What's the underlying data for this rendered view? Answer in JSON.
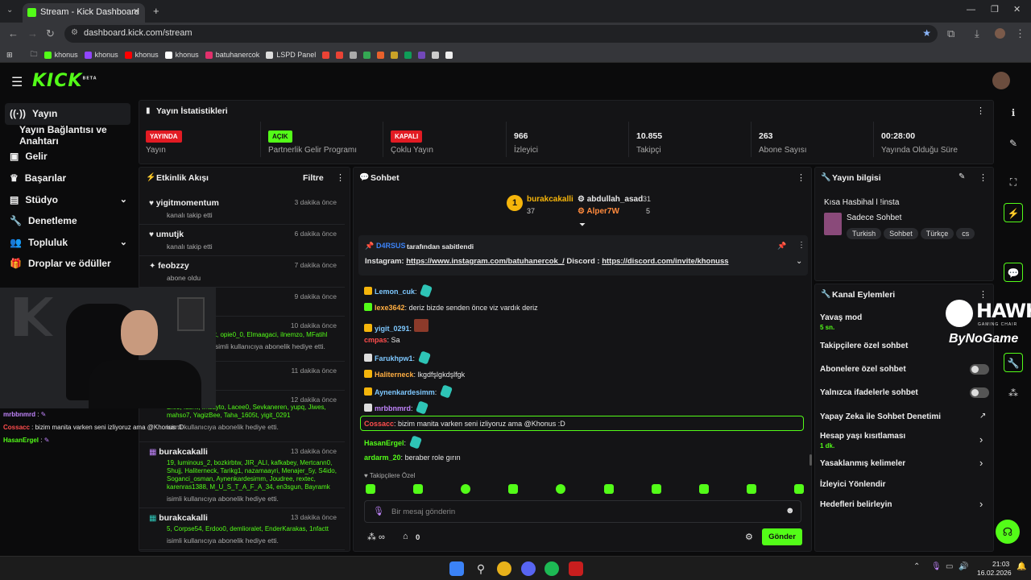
{
  "browser": {
    "tab_title": "Stream - Kick Dashboard",
    "url": "dashboard.kick.com/stream",
    "bookmarks": [
      "khonus",
      "khonus",
      "khonus",
      "khonus",
      "batuhanercok",
      "LSPD Panel"
    ]
  },
  "app": {
    "logo": "KICK",
    "beta": "BETA"
  },
  "sidebar": {
    "items": [
      {
        "label": "Yayın",
        "icon": "broadcast-icon"
      },
      {
        "label": "Yayın Bağlantısı ve Anahtarı",
        "icon": ""
      },
      {
        "label": "Gelir",
        "icon": "revenue-icon"
      },
      {
        "label": "Başarılar",
        "icon": "trophy-icon"
      },
      {
        "label": "Stüdyo",
        "icon": "studio-icon"
      },
      {
        "label": "Denetleme",
        "icon": "wrench-icon"
      },
      {
        "label": "Topluluk",
        "icon": "community-icon"
      },
      {
        "label": "Droplar ve ödüller",
        "icon": "drops-icon"
      }
    ]
  },
  "stats": {
    "title": "Yayın İstatistikleri",
    "cards": [
      {
        "badge": "YAYINDA",
        "label": "Yayın"
      },
      {
        "badge": "AÇIK",
        "label": "Partnerlik Gelir Programı"
      },
      {
        "badge": "KAPALI",
        "label": "Çoklu Yayın"
      },
      {
        "value": "966",
        "label": "İzleyici"
      },
      {
        "value": "10.855",
        "label": "Takipçi"
      },
      {
        "value": "263",
        "label": "Abone Sayısı"
      },
      {
        "value": "00:28:00",
        "label": "Yayında Olduğu Süre"
      }
    ]
  },
  "events": {
    "title": "Etkinlik Akışı",
    "filter": "Filtre",
    "items": [
      {
        "name": "yigitmomentum",
        "time": "3 dakika önce",
        "desc": "kanalı takip etti"
      },
      {
        "name": "umutjk",
        "time": "6 dakika önce",
        "desc": "kanalı takip etti"
      },
      {
        "name": "feobzzy",
        "time": "7 dakika önce",
        "desc": "abone oldu"
      },
      {
        "name": "",
        "time": "9 dakika önce",
        "desc": ""
      },
      {
        "name": "",
        "time": "10 dakika önce",
        "gifts": "lt, opie0_0, Elmaagaci, ilnemzo, MFatihl",
        "desc": "isimli kullanıcıya abonelik hediye etti."
      },
      {
        "name": "",
        "time": "11 dakika önce",
        "desc": ""
      },
      {
        "name": "",
        "time": "12 dakika önce",
        "gifts": "Efe3, fatihv, imsayto, Lacee0, Sevkaneren, yupq, Jiwes, mahso7, YagizBee, Taha_1605t, yigit_0291",
        "desc": "isimli kullanıcıya abonelik hediye etti."
      },
      {
        "name": "burakcakalli",
        "time": "13 dakika önce",
        "gifts": "19, luminous_2, bozkirbtw, JIR_ALI, kafkabey, Mertcann0, Shujj, Haliterneck, Tarikg1, nazamaayri, Menajer_5y, S4ido, Soganci_osman, Aynenkardesimm, Joudree, rextec, karenras1388, M_U_S_T_A_F_A_34, en3sgun, Bayramk",
        "desc": "isimli kullanıcıya abonelik hediye etti."
      },
      {
        "name": "burakcakalli",
        "time": "13 dakika önce",
        "gifts": "5, Corpse54, Erdoo0, demlioralet, EnderKarakas, 1nfactt",
        "desc": "isimli kullanıcıya abonelik hediye etti."
      }
    ]
  },
  "chat": {
    "title": "Sohbet",
    "leaders": [
      {
        "rank": "1",
        "name": "burakcakalli",
        "count": "37"
      },
      {
        "name": "abdullah_asad",
        "count": "31"
      },
      {
        "name": "Alper7W",
        "count": "5"
      }
    ],
    "pinned": {
      "by": "D4RSUS",
      "by_suffix": "tarafından sabitlendi",
      "text_a": "Instagram: ",
      "link_a": "https://www.instagram.com/batuhanercok_/",
      "text_b": " Discord : ",
      "link_b": "https://discord.com/invite/khonuss"
    },
    "messages": [
      {
        "user": "Lemon_cuk",
        "color": "#7ec8ff",
        "text": "",
        "emote": true
      },
      {
        "user": "lexe3642",
        "color": "#ffae42",
        "text": "deriz bizde senden önce viz vardık deriz"
      },
      {
        "user": "yigit_0291",
        "color": "#7ec8ff",
        "text": "",
        "emote": true
      },
      {
        "user": "cmpas",
        "color": "#ff4d4d",
        "text": "Sa"
      },
      {
        "user": "Farukhpw1",
        "color": "#7ec8ff",
        "text": "",
        "emote": true
      },
      {
        "user": "Haliterneck",
        "color": "#ffae42",
        "text": "lkgdfşlgkdşlfgk"
      },
      {
        "user": "Aynenkardesimm",
        "color": "#7ec8ff",
        "text": "",
        "emote": true
      },
      {
        "user": "mrbbnmrd",
        "color": "#c084fc",
        "text": "",
        "emote": true
      },
      {
        "user": "Cossacc",
        "color": "#ff4d4d",
        "text": "bizim manita varken seni izliyoruz ama @Khonus :D",
        "highlight": true
      },
      {
        "user": "HasanErgel",
        "color": "#53fc18",
        "text": "",
        "emote": true
      },
      {
        "user": "ardarm_20",
        "color": "#53fc18",
        "text": "beraber role gırın"
      }
    ],
    "emote_label": "Takipçilere Özel",
    "input_placeholder": "Bir mesaj gönderin",
    "points": "0",
    "send": "Gönder"
  },
  "info": {
    "title": "Yayın bilgisi",
    "stream_title": "Kısa Hasbihal l !insta",
    "category": "Sadece Sohbet",
    "tags": [
      "Turkish",
      "Sohbet",
      "Türkçe",
      "cs"
    ]
  },
  "actions": {
    "title": "Kanal Eylemleri",
    "items": [
      {
        "label": "Yavaş mod",
        "sub": "5 sn."
      },
      {
        "label": "Takipçilere özel sohbet"
      },
      {
        "label": "Abonelere özel sohbet",
        "toggle": true
      },
      {
        "label": "Yalnızca ifadelerle sohbet",
        "toggle": true
      },
      {
        "label": "Yapay Zeka ile Sohbet Denetimi"
      },
      {
        "label": "Hesap yaşı kısıtlaması",
        "sub": "1 dk."
      },
      {
        "label": "Yasaklanmış kelimeler"
      },
      {
        "label": "İzleyici Yönlendir"
      },
      {
        "label": "Hedefleri belirleyin"
      }
    ]
  },
  "overlay": {
    "hawk": "HAWK",
    "hawk_sub": "GAMING CHAIR",
    "bynogame": "ByNoGame",
    "webcam_chat": [
      {
        "user": "mrbbnmrd",
        "text": ""
      },
      {
        "user": "Cossacc",
        "text": "bizim manita varken seni izliyoruz ama @Khonus :D"
      },
      {
        "user": "HasanErgel",
        "text": ""
      }
    ]
  },
  "taskbar": {
    "time": "21:03",
    "date": "16.02.2026"
  }
}
